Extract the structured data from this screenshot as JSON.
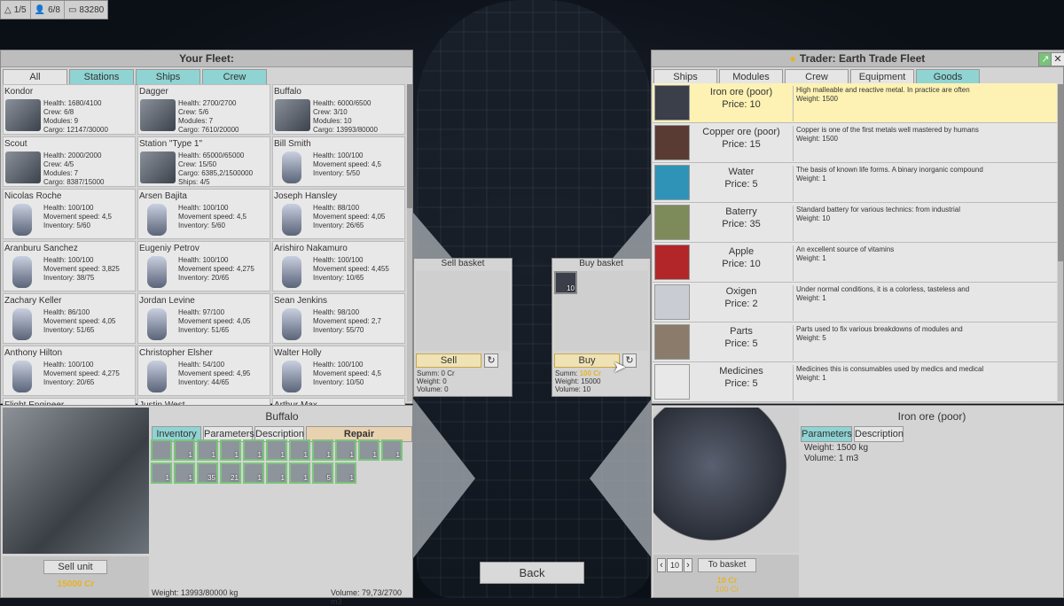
{
  "topbar": {
    "fleets": "1/5",
    "crew": "6/8",
    "credits": "83280"
  },
  "fleet_panel": {
    "title": "Your Fleet:",
    "tabs": [
      "All",
      "Stations",
      "Ships",
      "Crew"
    ],
    "units": [
      {
        "name": "Kondor",
        "lines": [
          "Health: 1680/4100",
          "Crew: 6/8",
          "Modules: 9",
          "Cargo: 12147/30000"
        ],
        "kind": "ship"
      },
      {
        "name": "Dagger",
        "lines": [
          "Health: 2700/2700",
          "Crew: 5/6",
          "Modules: 7",
          "Cargo: 7610/20000"
        ],
        "kind": "ship"
      },
      {
        "name": "Buffalo",
        "lines": [
          "Health: 6000/6500",
          "Crew: 3/10",
          "Modules: 10",
          "Cargo: 13993/80000"
        ],
        "kind": "ship"
      },
      {
        "name": "Scout",
        "lines": [
          "Health: 2000/2000",
          "Crew: 4/5",
          "Modules: 7",
          "Cargo: 8387/15000"
        ],
        "kind": "ship"
      },
      {
        "name": "Station \"Type 1\"",
        "lines": [
          "Health: 65000/65000",
          "Crew: 15/50",
          "Cargo: 6385,2/1500000",
          "Ships: 4/5"
        ],
        "kind": "station"
      },
      {
        "name": "Bill Smith",
        "lines": [
          "Health: 100/100",
          "Movement speed: 4,5",
          "Inventory: 5/50"
        ],
        "kind": "person"
      },
      {
        "name": "Nicolas Roche",
        "lines": [
          "Health: 100/100",
          "Movement speed: 4,5",
          "Inventory: 5/60"
        ],
        "kind": "person"
      },
      {
        "name": "Arsen Bajita",
        "lines": [
          "Health: 100/100",
          "Movement speed: 4,5",
          "Inventory: 5/60"
        ],
        "kind": "person"
      },
      {
        "name": "Joseph Hansley",
        "lines": [
          "Health: 88/100",
          "Movement speed: 4,05",
          "Inventory: 26/65"
        ],
        "kind": "person"
      },
      {
        "name": "Aranburu Sanchez",
        "lines": [
          "Health: 100/100",
          "Movement speed: 3,825",
          "Inventory: 38/75"
        ],
        "kind": "person"
      },
      {
        "name": "Eugeniy Petrov",
        "lines": [
          "Health: 100/100",
          "Movement speed: 4,275",
          "Inventory: 20/65"
        ],
        "kind": "person"
      },
      {
        "name": "Arishiro Nakamuro",
        "lines": [
          "Health: 100/100",
          "Movement speed: 4,455",
          "Inventory: 10/65"
        ],
        "kind": "person"
      },
      {
        "name": "Zachary Keller",
        "lines": [
          "Health: 86/100",
          "Movement speed: 4,05",
          "Inventory: 51/65"
        ],
        "kind": "person"
      },
      {
        "name": "Jordan Levine",
        "lines": [
          "Health: 97/100",
          "Movement speed: 4,05",
          "Inventory: 51/65"
        ],
        "kind": "person"
      },
      {
        "name": "Sean Jenkins",
        "lines": [
          "Health: 98/100",
          "Movement speed: 2,7",
          "Inventory: 55/70"
        ],
        "kind": "person"
      },
      {
        "name": "Anthony Hilton",
        "lines": [
          "Health: 100/100",
          "Movement speed: 4,275",
          "Inventory: 20/65"
        ],
        "kind": "person"
      },
      {
        "name": "Christopher Elsher",
        "lines": [
          "Health: 54/100",
          "Movement speed: 4,95",
          "Inventory: 44/65"
        ],
        "kind": "person"
      },
      {
        "name": "Walter Holly",
        "lines": [
          "Health: 100/100",
          "Movement speed: 4,5",
          "Inventory: 10/50"
        ],
        "kind": "person"
      },
      {
        "name": "Flight Engineer",
        "lines": [],
        "kind": "person"
      },
      {
        "name": "Justin West",
        "lines": [],
        "kind": "person"
      },
      {
        "name": "Arthur Max",
        "lines": [],
        "kind": "person"
      }
    ]
  },
  "unit_detail": {
    "title": "Buffalo",
    "tabs": [
      "Inventory",
      "Parameters",
      "Description",
      "Repair"
    ],
    "sell_label": "Sell unit",
    "sell_price": "15000 Cr",
    "weight": "Weight: 13993/80000 kg",
    "volume": "Volume: 79,73/2700 m3",
    "slots": [
      {
        "count": ""
      },
      {
        "count": "1"
      },
      {
        "count": "1"
      },
      {
        "count": "1"
      },
      {
        "count": "1"
      },
      {
        "count": "1"
      },
      {
        "count": "1"
      },
      {
        "count": "1"
      },
      {
        "count": "1"
      },
      {
        "count": "1"
      },
      {
        "count": "1"
      },
      {
        "count": "1"
      },
      {
        "count": "1"
      },
      {
        "count": "35"
      },
      {
        "count": "21"
      },
      {
        "count": "1"
      },
      {
        "count": "1"
      },
      {
        "count": "1"
      },
      {
        "count": "5"
      },
      {
        "count": "1"
      }
    ]
  },
  "sell_basket": {
    "title": "Sell basket",
    "button": "Sell",
    "summ": "Summ: 0 Cr",
    "weight": "Weight: 0",
    "volume": "Volume: 0"
  },
  "buy_basket": {
    "title": "Buy basket",
    "item_count": "10",
    "button": "Buy",
    "summ_label": "Summ:",
    "summ_value": "100 Cr",
    "weight": "Weight: 15000",
    "volume": "Volume: 10"
  },
  "back_label": "Back",
  "trader": {
    "title": "Trader: Earth Trade Fleet",
    "tabs": [
      "Ships",
      "Modules",
      "Crew",
      "Equipment",
      "Goods"
    ],
    "goods": [
      {
        "name": "Iron ore (poor)",
        "price": "Price: 10",
        "desc": "High malleable and reactive metal. In practice are often",
        "weight": "Weight: 1500",
        "color": "#3a3f4a"
      },
      {
        "name": "Copper ore (poor)",
        "price": "Price: 15",
        "desc": "Copper is one of the first metals well mastered by humans",
        "weight": "Weight: 1500",
        "color": "#5a3b33"
      },
      {
        "name": "Water",
        "price": "Price: 5",
        "desc": "The basis of known life forms. A binary inorganic compound",
        "weight": "Weight: 1",
        "color": "#2f93b8"
      },
      {
        "name": "Baterry",
        "price": "Price: 35",
        "desc": "Standard battery for various technics: from industrial",
        "weight": "Weight: 10",
        "color": "#7d8a5a"
      },
      {
        "name": "Apple",
        "price": "Price: 10",
        "desc": "An excellent source of vitamins",
        "weight": "Weight: 1",
        "color": "#b2262a"
      },
      {
        "name": "Oxigen",
        "price": "Price: 2",
        "desc": "Under normal conditions, it is a colorless, tasteless and",
        "weight": "Weight: 1",
        "color": "#c9cdd3"
      },
      {
        "name": "Parts",
        "price": "Price: 5",
        "desc": "Parts used to fix various breakdowns of modules and",
        "weight": "Weight: 5",
        "color": "#8a7b6a"
      },
      {
        "name": "Medicines",
        "price": "Price: 5",
        "desc": "Medicines this is consumables used by medics and medical",
        "weight": "Weight: 1",
        "color": "#e8e8e8"
      }
    ],
    "detail": {
      "title": "Iron ore (poor)",
      "tabs": [
        "Parameters",
        "Description"
      ],
      "weight": "Weight: 1500 kg",
      "volume": "Volume: 1 m3",
      "quantity": "10",
      "to_basket": "To basket",
      "price1": "10 Cr",
      "price2": "100 Cr"
    }
  }
}
